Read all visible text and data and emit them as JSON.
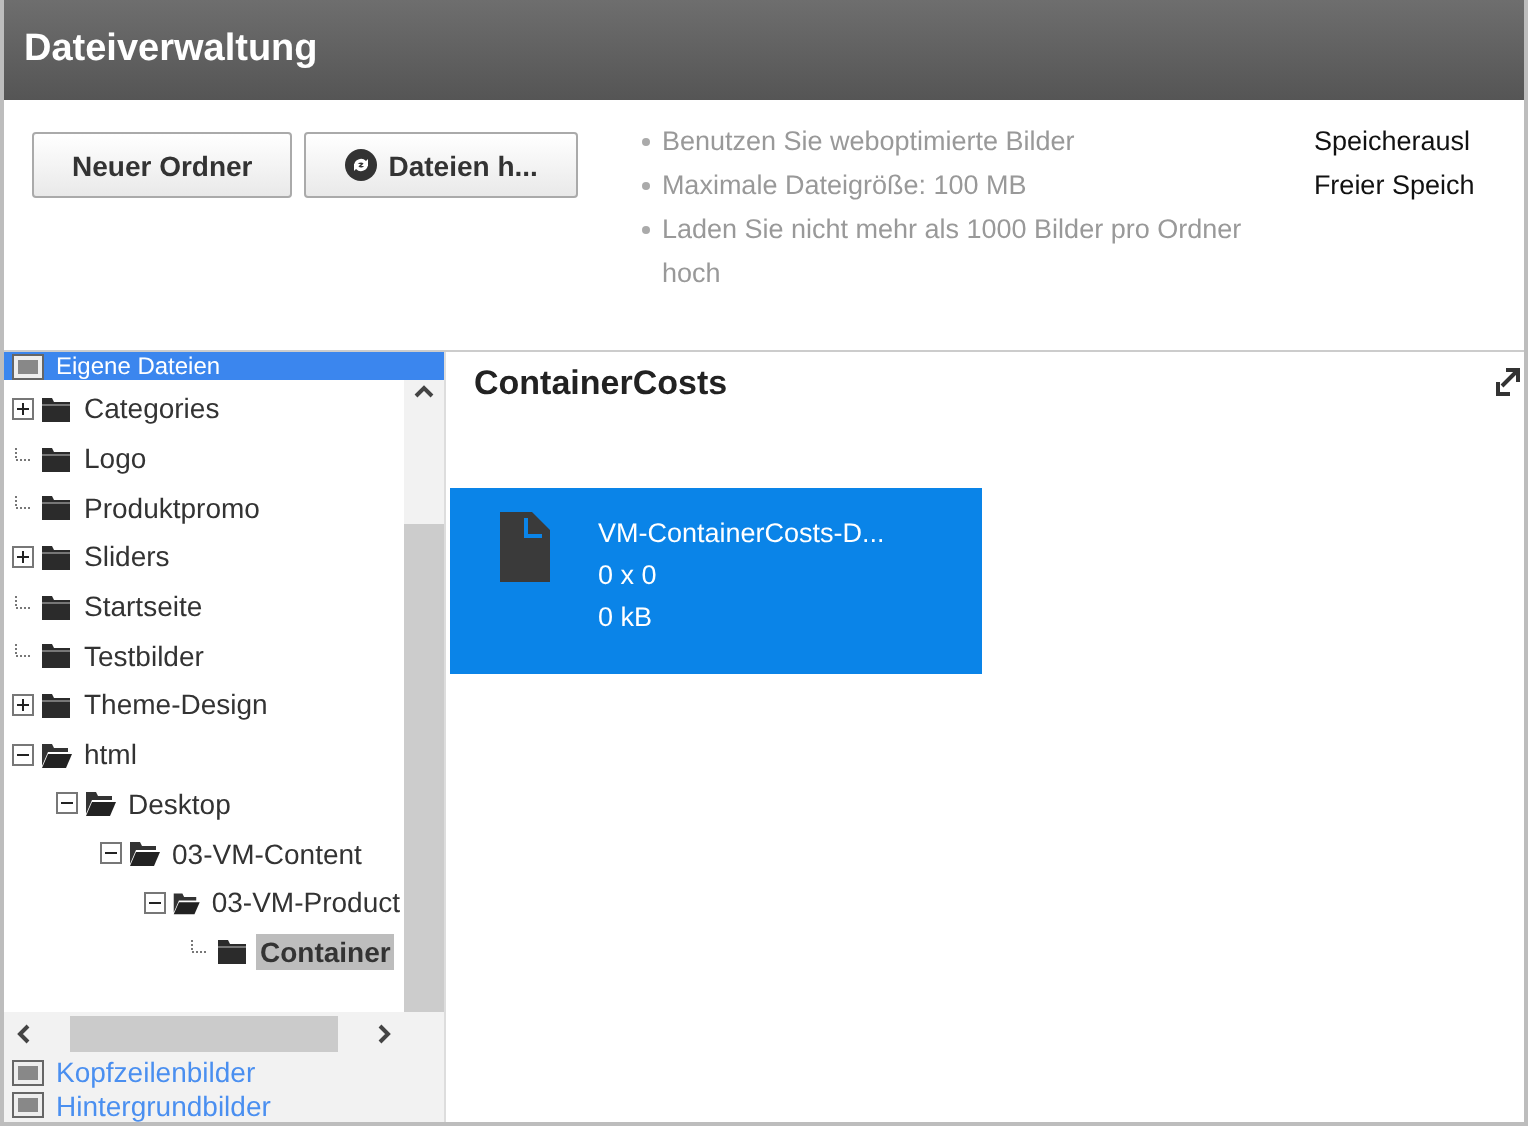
{
  "window": {
    "title": "Dateiverwaltung"
  },
  "toolbar": {
    "buttons": [
      {
        "label": "Neuer Ordner",
        "kind": "plain"
      },
      {
        "label": "Dateien h...",
        "kind": "upload"
      }
    ],
    "hints": [
      "Benutzen Sie weboptimierte Bilder",
      "Maximale Dateigröße: 100 MB",
      "Laden Sie nicht mehr als 1000 Bilder pro Ordner hoch"
    ],
    "storage": [
      "Speicherausl",
      "Freier Speich"
    ]
  },
  "sidebar": {
    "sections": [
      {
        "label": "Eigene Dateien",
        "selected": true,
        "tree": [
          {
            "label": "Categories",
            "kind": "branch",
            "expanded": false,
            "selected": false
          },
          {
            "label": "Logo",
            "kind": "leaf",
            "selected": false
          },
          {
            "label": "Produktpromo",
            "kind": "leaf",
            "selected": false
          },
          {
            "label": "Sliders",
            "kind": "branch",
            "expanded": false,
            "selected": false
          },
          {
            "label": "Startseite",
            "kind": "leaf",
            "selected": false
          },
          {
            "label": "Testbilder",
            "kind": "leaf",
            "selected": false
          },
          {
            "label": "Theme-Design",
            "kind": "branch",
            "expanded": false,
            "selected": false
          },
          {
            "label": "html",
            "kind": "branch",
            "expanded": true,
            "selected": false,
            "children": [
              {
                "label": "Desktop",
                "kind": "branch",
                "expanded": true,
                "selected": false,
                "children": [
                  {
                    "label": "03-VM-Content",
                    "kind": "branch",
                    "expanded": true,
                    "selected": false,
                    "children": [
                      {
                        "label": "03-VM-Product",
                        "kind": "branch",
                        "expanded": true,
                        "selected": false,
                        "children": [
                          {
                            "label": "Container",
                            "kind": "leaf",
                            "selected": true
                          }
                        ]
                      }
                    ]
                  }
                ]
              }
            ]
          }
        ]
      },
      {
        "label": "Kopfzeilenbilder",
        "selected": false
      },
      {
        "label": "Hintergrundbilder",
        "selected": false
      }
    ]
  },
  "content": {
    "title": "ContainerCosts",
    "files": [
      {
        "name": "VM-ContainerCosts-D...",
        "dimensions": "0 x 0",
        "size": "0 kB",
        "selected": true
      }
    ]
  }
}
